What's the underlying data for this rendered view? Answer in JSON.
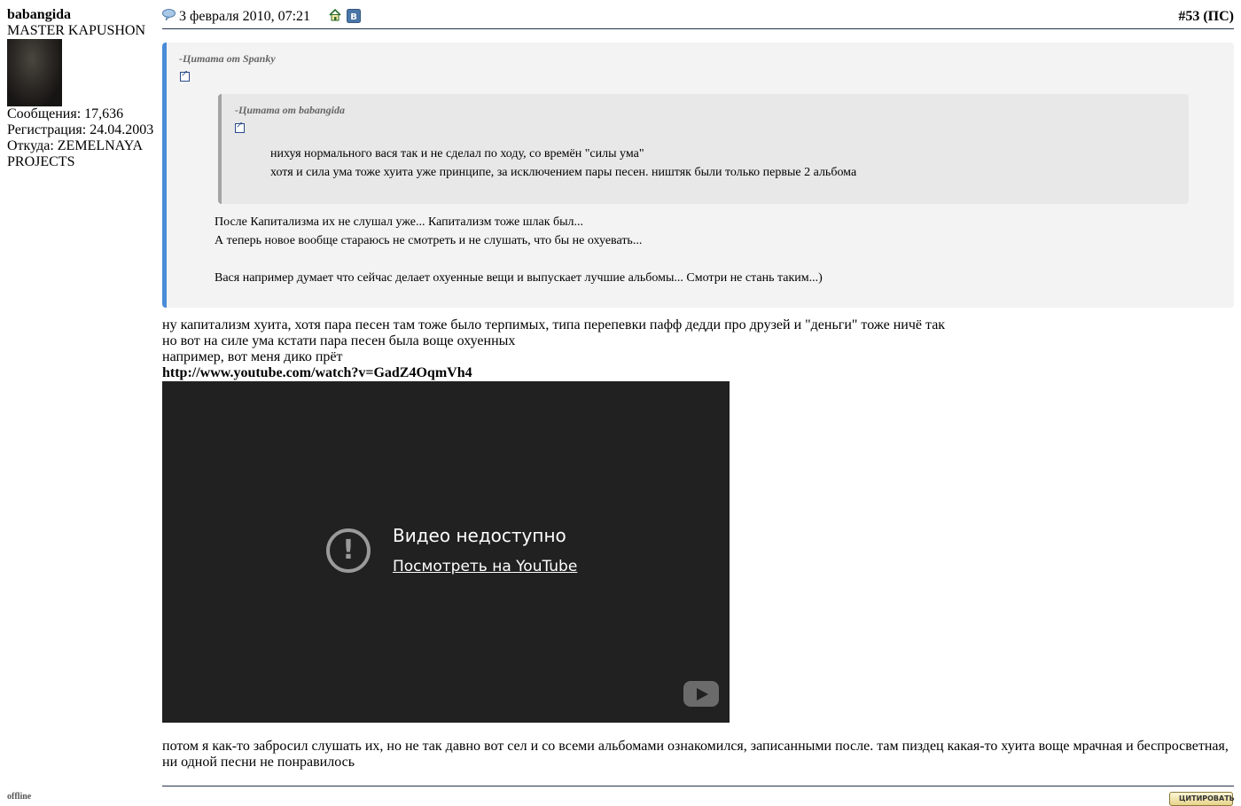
{
  "user": {
    "name": "babangida",
    "title": "MASTER KAPUSHON",
    "posts": "Сообщения: 17,636",
    "registered": "Регистрация: 24.04.2003",
    "location_line1": "Откуда: ZEMELNAYA",
    "location_line2": "PROJECTS",
    "status": "offline"
  },
  "post": {
    "date": "3 февраля 2010, 07:21",
    "number": "#53",
    "suffix_open": " (",
    "suffix_ps": "ПС",
    "suffix_close": ")"
  },
  "quote_outer": {
    "header": "-Цитата от Spanky",
    "lines": [
      "После Капитализма их не слушал уже... Капитализм тоже шлак был...",
      "А теперь новое вообще стараюсь не смотреть и не слушать, что бы не охуевать...",
      "Вася например думает что сейчас делает охуенные вещи и выпускает лучшие альбомы... Смотри не стань таким...)"
    ]
  },
  "quote_inner": {
    "header": "-Цитата от babangida",
    "lines": [
      "нихуя нормального вася так и не сделал по ходу, со времён \"силы ума\"",
      "хотя и сила ума тоже хуита уже принципе, за исключением пары песен. ништяк были только первые 2 альбома"
    ]
  },
  "message": {
    "lines": [
      "ну капитализм хуита, хотя пара песен там тоже было терпимых, типа перепевки пафф дедди про друзей и \"деньги\" тоже ничё так",
      "но вот на силе ума кстати пара песен была воще охуенных",
      "например, вот меня дико прёт"
    ],
    "link": "http://www.youtube.com/watch?v=GadZ4OqmVh4",
    "after": "потом я как-то забросил слушать их, но не так давно вот сел и со всеми альбомами ознакомился, записанными после. там пиздец какая-то хуита воще мрачная и беспросветная, ни одной песни не понравилось"
  },
  "video": {
    "title": "Видео недоступно",
    "link": "Посмотреть на YouTube"
  },
  "buttons": {
    "quote": "ЦИТИРОВАТЬ"
  }
}
